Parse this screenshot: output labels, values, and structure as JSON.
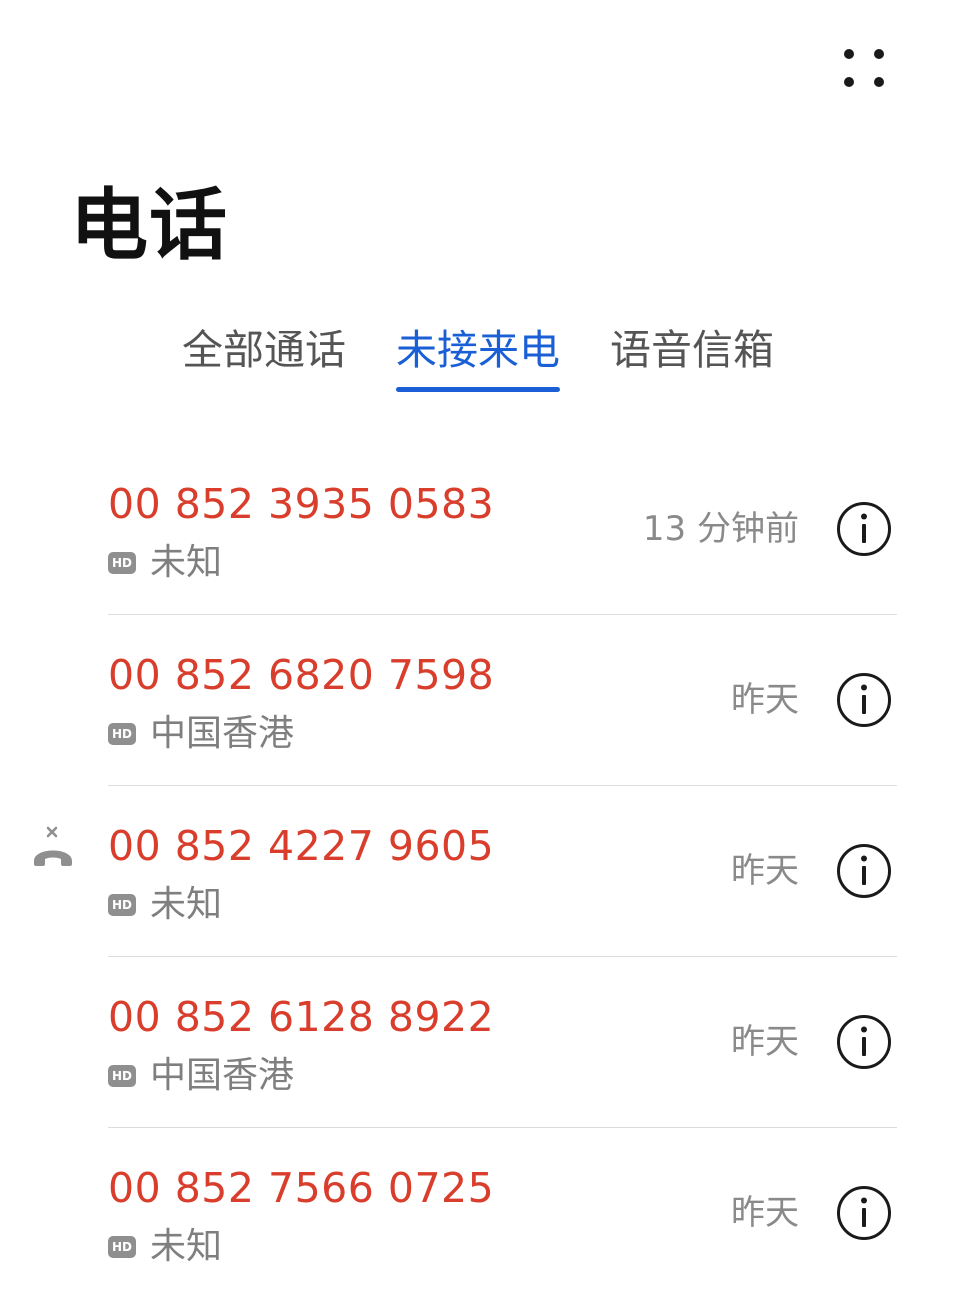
{
  "header": {
    "title": "电话"
  },
  "tabs": [
    {
      "label": "全部通话",
      "active": false
    },
    {
      "label": "未接来电",
      "active": true
    },
    {
      "label": "语音信箱",
      "active": false
    }
  ],
  "calls": [
    {
      "number": "00 852 3935 0583",
      "badge": "HD",
      "location": "未知",
      "time": "13 分钟前",
      "missed_icon": false
    },
    {
      "number": "00 852 6820 7598",
      "badge": "HD",
      "location": "中国香港",
      "time": "昨天",
      "missed_icon": false
    },
    {
      "number": "00 852 4227 9605",
      "badge": "HD",
      "location": "未知",
      "time": "昨天",
      "missed_icon": true
    },
    {
      "number": "00 852 6128 8922",
      "badge": "HD",
      "location": "中国香港",
      "time": "昨天",
      "missed_icon": false
    },
    {
      "number": "00 852 7566 0725",
      "badge": "HD",
      "location": "未知",
      "time": "昨天",
      "missed_icon": false
    }
  ],
  "icons": {
    "more": "more-dots-icon",
    "info": "info-icon",
    "missed": "missed-call-icon"
  },
  "colors": {
    "accent": "#1a5fd6",
    "missed_number": "#d93d2c",
    "secondary_text": "#8a8a8a"
  }
}
